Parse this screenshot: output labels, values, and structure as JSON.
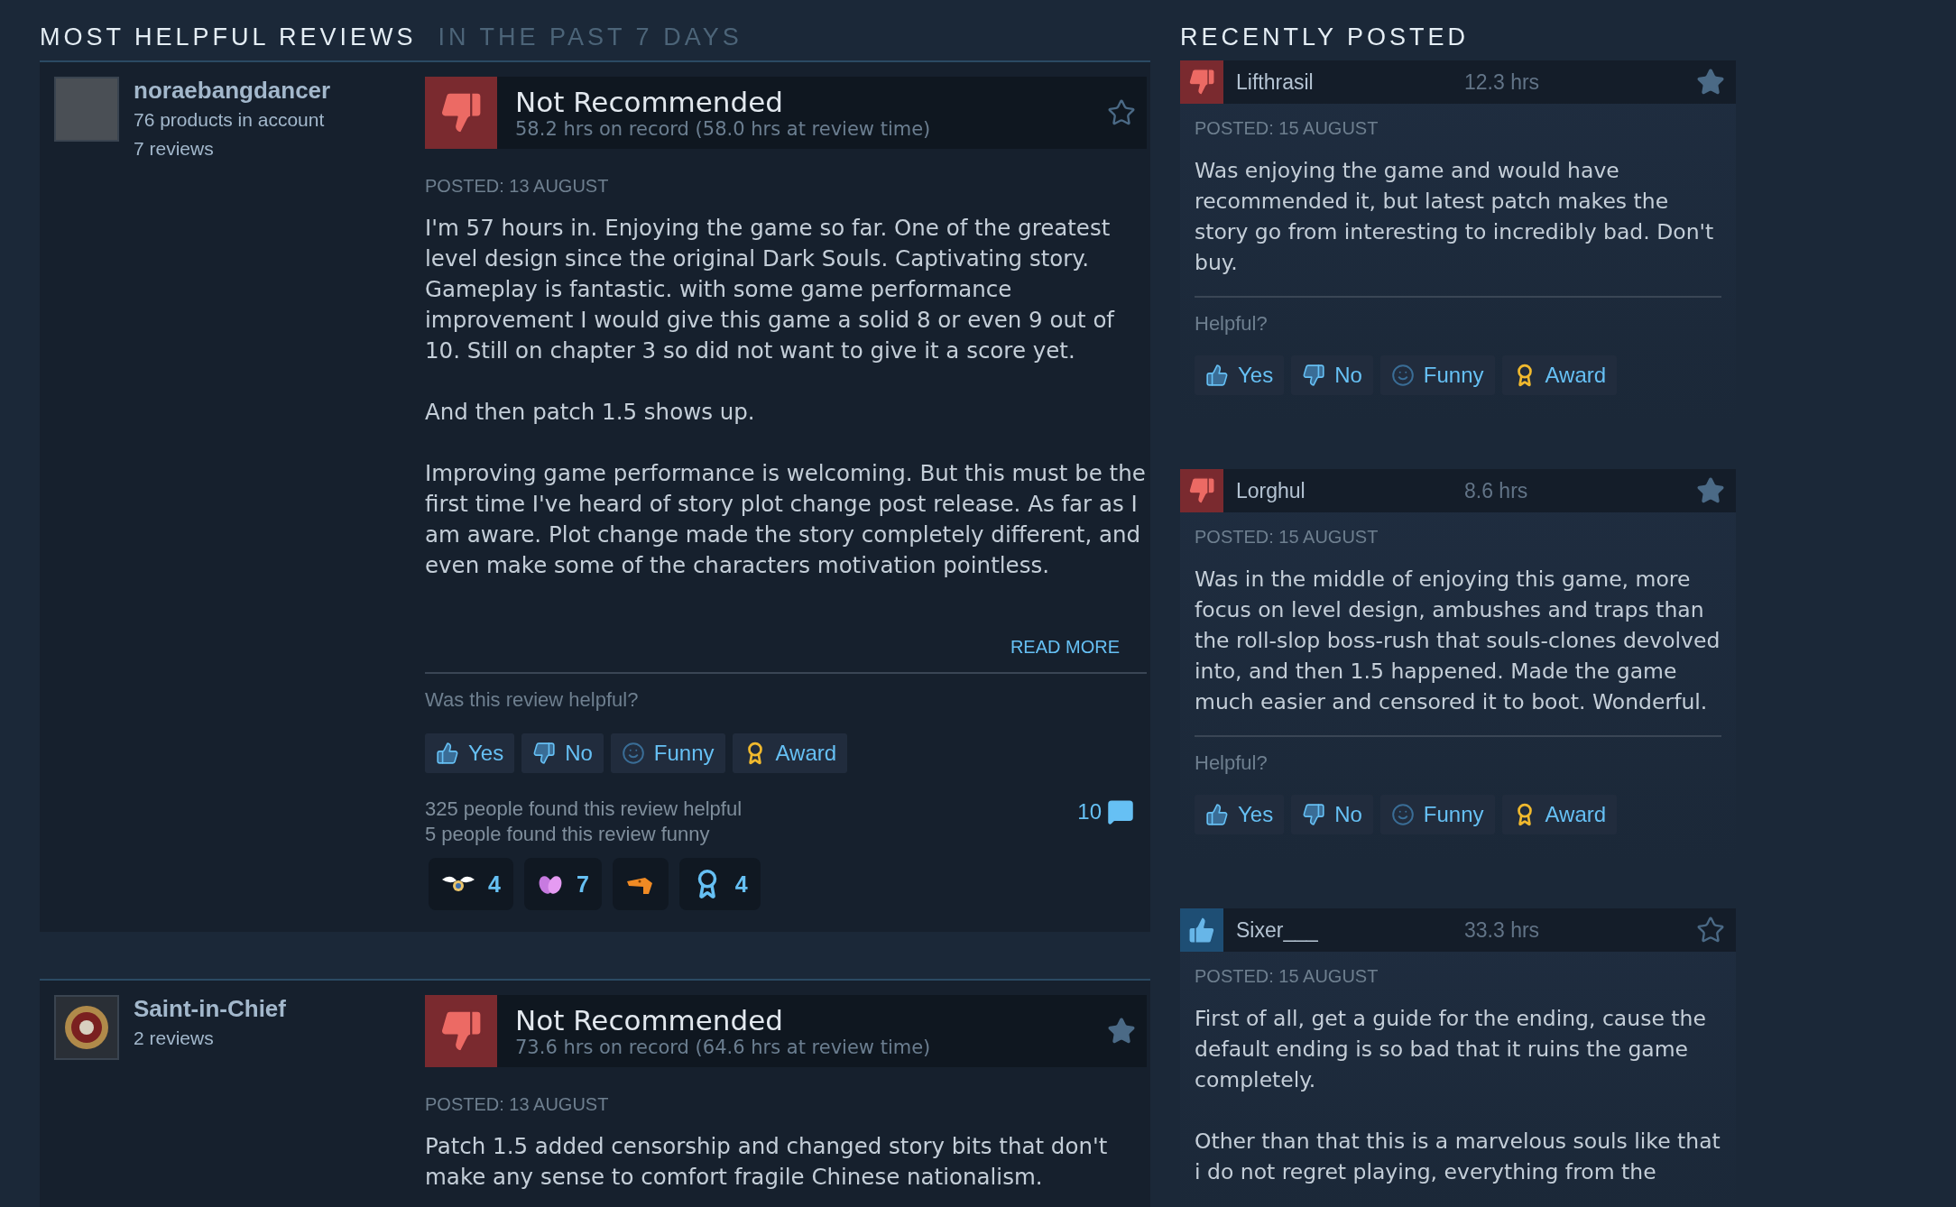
{
  "helpful_section": {
    "title": "MOST HELPFUL REVIEWS",
    "subtitle": "IN THE PAST 7 DAYS",
    "reviews": [
      {
        "author": {
          "name": "noraebangdancer",
          "avatar": {
            "kind": "photo"
          },
          "details": [
            "76 products in account",
            "7 reviews"
          ]
        },
        "verdict": {
          "kind": "not_recommended",
          "label": "Not Recommended"
        },
        "hours": "58.2 hrs on record (58.0 hrs at review time)",
        "starred": false,
        "posted": "POSTED: 13 AUGUST",
        "paragraphs": [
          "I'm 57 hours in. Enjoying the game so far. One of the greatest level design since the original Dark Souls. Captivating story. Gameplay is fantastic. with some game performance improvement I would give this game a solid 8 or even 9 out of 10. Still on chapter 3 so did not want to give it a score yet.",
          "And then patch 1.5 shows up.",
          "Improving game performance is welcoming. But this must be the first time I've heard of story plot change post release. As far as I am aware. Plot change made the story completely different, and even make some of the characters motivation pointless."
        ],
        "read_more": "READ MORE",
        "helpful_prompt": "Was this review helpful?",
        "vote_buttons": [
          {
            "kind": "yes",
            "label": "Yes"
          },
          {
            "kind": "no",
            "label": "No"
          },
          {
            "kind": "funny",
            "label": "Funny"
          },
          {
            "kind": "award",
            "label": "Award"
          }
        ],
        "helpful_count": "325 people found this review helpful",
        "funny_count": "5 people found this review funny",
        "comments_count": "10",
        "awards": [
          {
            "kind": "wings",
            "count": "4"
          },
          {
            "kind": "hands",
            "count": "7"
          },
          {
            "kind": "creature"
          },
          {
            "kind": "ribbon",
            "count": "4"
          }
        ]
      },
      {
        "author": {
          "name": "Saint-in-Chief",
          "avatar": {
            "kind": "emblem"
          },
          "details": [
            "2 reviews"
          ]
        },
        "verdict": {
          "kind": "not_recommended",
          "label": "Not Recommended"
        },
        "hours": "73.6 hrs on record (64.6 hrs at review time)",
        "starred": true,
        "posted": "POSTED: 13 AUGUST",
        "paragraphs": [
          "Patch 1.5 added censorship and changed story bits that don't make any sense to comfort fragile Chinese nationalism."
        ]
      }
    ]
  },
  "recent_section": {
    "title": "RECENTLY POSTED",
    "reviews": [
      {
        "verdict": {
          "kind": "not_recommended"
        },
        "name": "Lifthrasil",
        "hours": "12.3 hrs",
        "starred": true,
        "posted": "POSTED: 15 AUGUST",
        "paragraphs": [
          "Was enjoying the game and would have recommended it, but latest patch makes the story go from interesting to incredibly bad. Don't buy."
        ],
        "helpful_prompt": "Helpful?",
        "vote_buttons": [
          {
            "kind": "yes",
            "label": "Yes"
          },
          {
            "kind": "no",
            "label": "No"
          },
          {
            "kind": "funny",
            "label": "Funny"
          },
          {
            "kind": "award",
            "label": "Award"
          }
        ]
      },
      {
        "verdict": {
          "kind": "not_recommended"
        },
        "name": "Lorghul",
        "hours": "8.6 hrs",
        "starred": true,
        "posted": "POSTED: 15 AUGUST",
        "paragraphs": [
          "Was in the middle of enjoying this game, more focus on level design, ambushes and traps than the roll-slop boss-rush that souls-clones devolved into, and then 1.5 happened. Made the game much easier and censored it to boot. Wonderful."
        ],
        "helpful_prompt": "Helpful?",
        "vote_buttons": [
          {
            "kind": "yes",
            "label": "Yes"
          },
          {
            "kind": "no",
            "label": "No"
          },
          {
            "kind": "funny",
            "label": "Funny"
          },
          {
            "kind": "award",
            "label": "Award"
          }
        ]
      },
      {
        "verdict": {
          "kind": "recommended"
        },
        "name": "Sixer___",
        "hours": "33.3 hrs",
        "starred": false,
        "posted": "POSTED: 15 AUGUST",
        "paragraphs": [
          "First of all, get a guide for the ending, cause the default ending is so bad that it ruins the game completely.",
          "Other than that this is a marvelous souls like that i do not regret playing, everything from the"
        ]
      }
    ]
  }
}
